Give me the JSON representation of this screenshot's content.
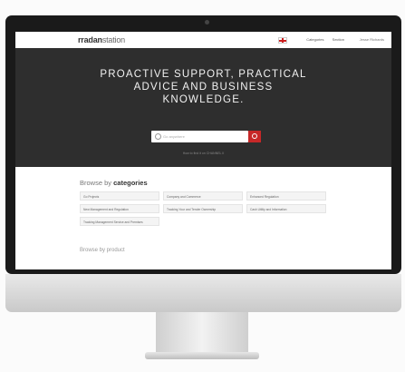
{
  "site": {
    "logo_main": "rradan",
    "logo_sub": "station"
  },
  "nav": {
    "items": [
      "Categories",
      "Section"
    ],
    "signin": "Jesse Richards"
  },
  "hero": {
    "headline_line1": "PROACTIVE SUPPORT, PRACTICAL",
    "headline_line2": "ADVICE AND BUSINESS",
    "headline_line3": "KNOWLEDGE.",
    "search_placeholder": "Go anywhere",
    "hint": "How to find it on CHANNEL II"
  },
  "categories": {
    "title_prefix": "Browse by ",
    "title_bold": "categories",
    "items": [
      "Go Projects",
      "Company and Commerce",
      "Enhanced Regulation",
      "New Management and Regulation",
      "Tracking Your and Tender Ownership",
      "Cash Utility and Information",
      "Tracking Management Service and Premises"
    ]
  },
  "section2": {
    "title": "Browse by product"
  },
  "colors": {
    "hero_bg": "#2e2e2e",
    "accent": "#c62828"
  }
}
